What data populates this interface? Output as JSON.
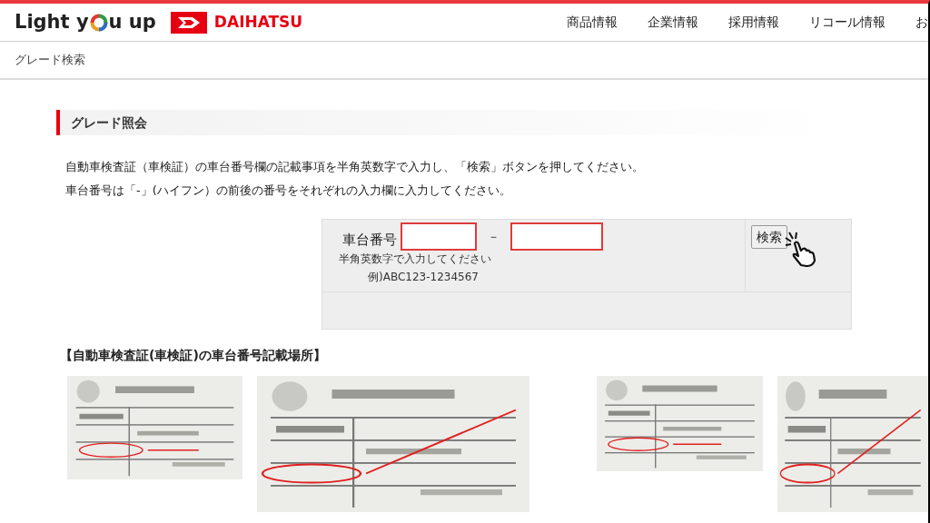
{
  "header": {
    "logo_parts": [
      "Light y",
      "u up"
    ],
    "brand": "DAIHATSU",
    "nav": [
      "商品情報",
      "企業情報",
      "採用情報",
      "リコール情報",
      "お"
    ]
  },
  "breadcrumb": "グレード検索",
  "section": {
    "title": "グレード照会",
    "paragraphs": [
      "自動車検査証（車検証）の車台番号欄の記載事項を半角英数字で入力し、「検索」ボタンを押してください。",
      "車台番号は「-」(ハイフン）の前後の番号をそれぞれの入力欄に入力してください。"
    ]
  },
  "form": {
    "label": "車台番号",
    "separator": "－",
    "hint": "半角英数字で入力してください",
    "example": "例)ABC123-1234567",
    "button": "検索"
  },
  "examples": {
    "title": "【自動車検査証(車検証)の車台番号記載場所】"
  }
}
